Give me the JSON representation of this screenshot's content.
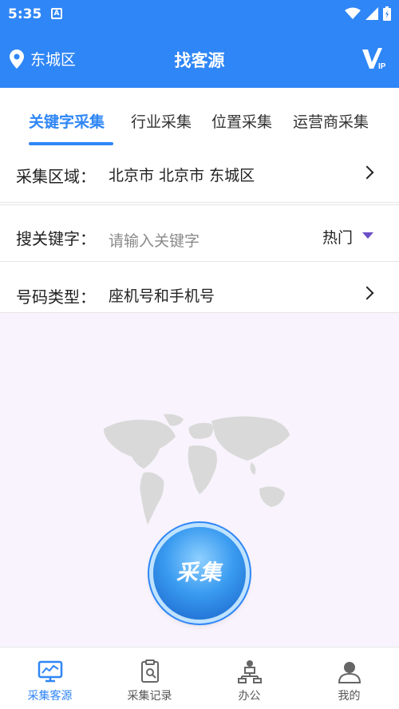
{
  "status_bar": {
    "time": "5:35",
    "a_icon_letter": "A"
  },
  "header": {
    "location": "东城区",
    "title": "找客源"
  },
  "tabs": [
    {
      "label": "关键字采集",
      "active": true
    },
    {
      "label": "行业采集",
      "active": false
    },
    {
      "label": "位置采集",
      "active": false
    },
    {
      "label": "运营商采集",
      "active": false
    }
  ],
  "form": {
    "region": {
      "label": "采集区域：",
      "value": "北京市 北京市 东城区"
    },
    "keyword": {
      "label": "搜关键字：",
      "placeholder": "请输入关键字",
      "hot_label": "热门"
    },
    "number_type": {
      "label": "号码类型：",
      "value": "座机号和手机号"
    }
  },
  "collect_button": {
    "label": "采集"
  },
  "bottom_nav": [
    {
      "label": "采集客源",
      "icon": "monitor-chart-icon",
      "active": true
    },
    {
      "label": "采集记录",
      "icon": "clipboard-search-icon",
      "active": false
    },
    {
      "label": "办公",
      "icon": "office-network-icon",
      "active": false
    },
    {
      "label": "我的",
      "icon": "user-profile-icon",
      "active": false
    }
  ],
  "colors": {
    "primary": "#2f86f6",
    "content_bg": "#f8f3fc",
    "dropdown_triangle": "#6b4fc8"
  }
}
